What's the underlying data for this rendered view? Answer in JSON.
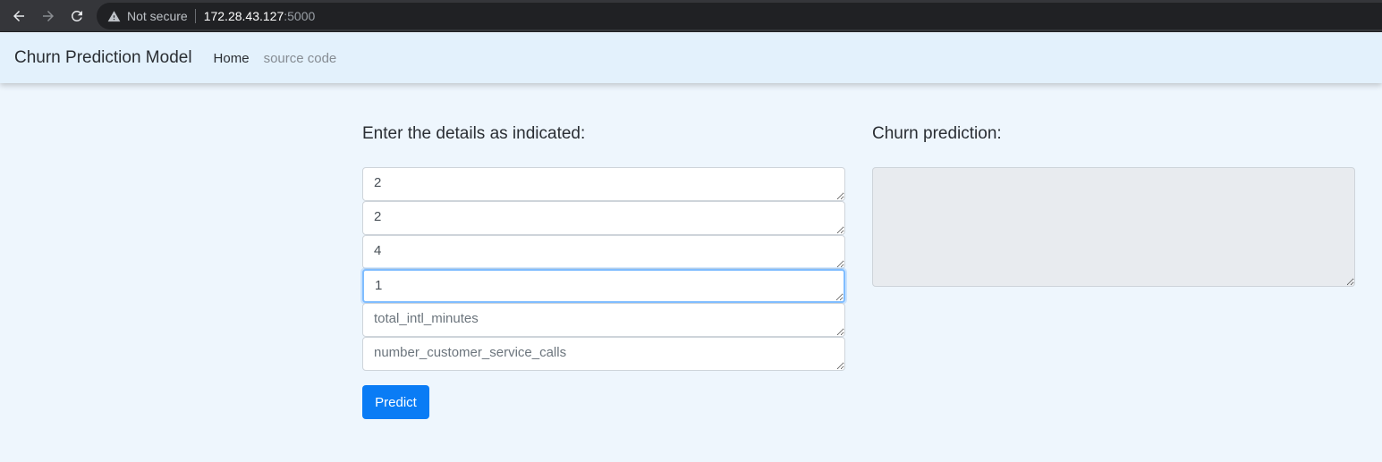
{
  "browser": {
    "security_label": "Not secure",
    "url_host": "172.28.43.127",
    "url_port": ":5000"
  },
  "navbar": {
    "brand": "Churn Prediction Model",
    "links": [
      {
        "label": "Home"
      },
      {
        "label": "source code"
      }
    ]
  },
  "form": {
    "title": "Enter the details as indicated:",
    "fields": [
      {
        "value": "2",
        "placeholder": ""
      },
      {
        "value": "2",
        "placeholder": ""
      },
      {
        "value": "4",
        "placeholder": ""
      },
      {
        "value": "1",
        "placeholder": ""
      },
      {
        "value": "",
        "placeholder": "total_intl_minutes"
      },
      {
        "value": "",
        "placeholder": "number_customer_service_calls"
      }
    ],
    "submit_label": "Predict"
  },
  "result": {
    "title": "Churn prediction:",
    "value": ""
  },
  "colors": {
    "accent": "#0a7cf5",
    "navbar_bg": "#e3f1fc",
    "page_bg": "#eef6fd"
  }
}
